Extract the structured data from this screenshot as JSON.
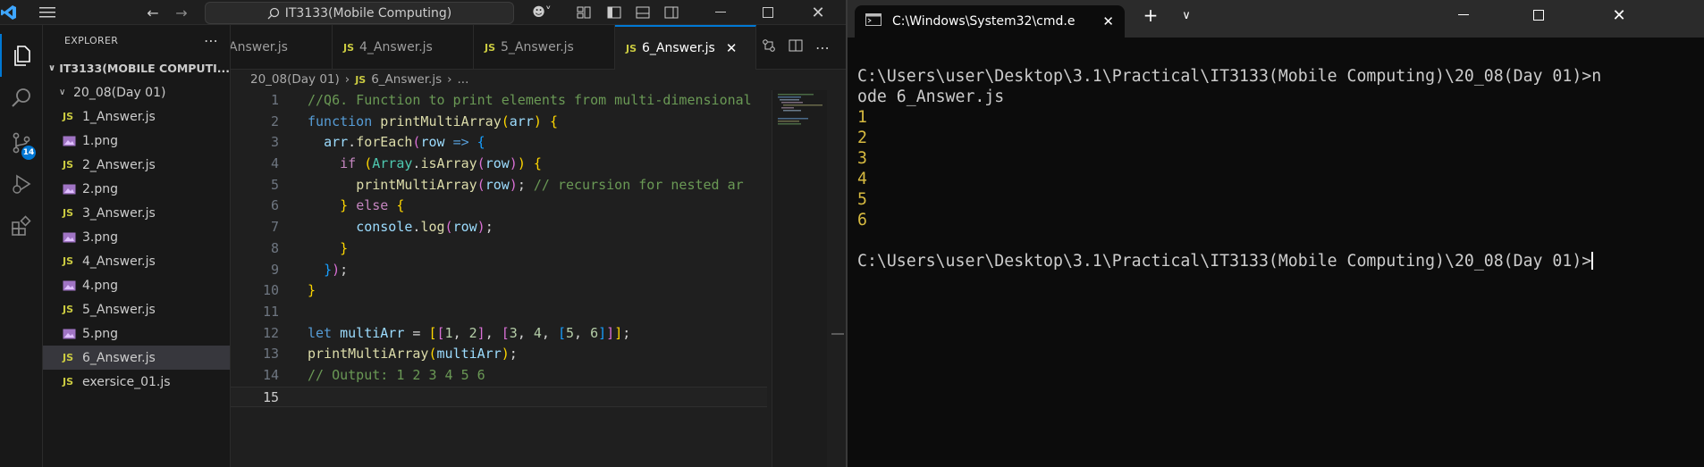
{
  "vscode": {
    "search_text": "IT3133(Mobile Computing)",
    "explorer_title": "EXPLORER",
    "scm_badge": "14",
    "root_folder": "IT3133(MOBILE COMPUTI...",
    "subfolder": "20_08(Day 01)",
    "files": [
      {
        "name": "1_Answer.js",
        "kind": "js"
      },
      {
        "name": "1.png",
        "kind": "png"
      },
      {
        "name": "2_Answer.js",
        "kind": "js"
      },
      {
        "name": "2.png",
        "kind": "png"
      },
      {
        "name": "3_Answer.js",
        "kind": "js"
      },
      {
        "name": "3.png",
        "kind": "png"
      },
      {
        "name": "4_Answer.js",
        "kind": "js"
      },
      {
        "name": "4.png",
        "kind": "png"
      },
      {
        "name": "5_Answer.js",
        "kind": "js"
      },
      {
        "name": "5.png",
        "kind": "png"
      },
      {
        "name": "6_Answer.js",
        "kind": "js",
        "selected": true
      },
      {
        "name": "exersice_01.js",
        "kind": "js"
      }
    ],
    "tabs": [
      "Answer.js",
      "4_Answer.js",
      "5_Answer.js",
      "6_Answer.js"
    ],
    "tab_js_label": "JS",
    "breadcrumb": {
      "folder": "20_08(Day 01)",
      "file": "6_Answer.js",
      "tail": "..."
    },
    "line_numbers": [
      "1",
      "2",
      "3",
      "4",
      "5",
      "6",
      "7",
      "8",
      "9",
      "10",
      "11",
      "12",
      "13",
      "14",
      "15"
    ],
    "code": {
      "l1_comment": "//Q6. Function to print elements from multi-dimensional",
      "l2_kw": "function",
      "l2_fn": "printMultiArray",
      "l2_param": "arr",
      "l3_var": "arr",
      "l3_method": "forEach",
      "l3_param": "row",
      "l3_arrow": "=>",
      "l4_kw": "if",
      "l4_type": "Array",
      "l4_method": "isArray",
      "l4_arg": "row",
      "l5_fn": "printMultiArray",
      "l5_arg": "row",
      "l5_comment": "// recursion for nested ar",
      "l6_kw": "else",
      "l7_obj": "console",
      "l7_method": "log",
      "l7_arg": "row",
      "l12_kw": "let",
      "l12_var": "multiArr",
      "l12_nums": [
        "1",
        "2",
        "3",
        "4",
        "5",
        "6"
      ],
      "l13_fn": "printMultiArray",
      "l13_arg": "multiArr",
      "l14_comment": "// Output: 1 2 3 4 5 6"
    }
  },
  "terminal": {
    "tab_title": "C:\\Windows\\System32\\cmd.e",
    "prompt_line1": "C:\\Users\\user\\Desktop\\3.1\\Practical\\IT3133(Mobile Computing)\\20_08(Day 01)>n",
    "prompt_line2": "ode 6_Answer.js",
    "outputs": [
      "1",
      "2",
      "3",
      "4",
      "5",
      "6"
    ],
    "final_prompt": "C:\\Users\\user\\Desktop\\3.1\\Practical\\IT3133(Mobile Computing)\\20_08(Day 01)>"
  },
  "colors": {
    "accent": "#0078d4",
    "js_icon": "#cbcb41",
    "terminal_output": "#d7ba40",
    "editor_bg": "#1f1f1f",
    "terminal_bg": "#0c0c0c"
  }
}
